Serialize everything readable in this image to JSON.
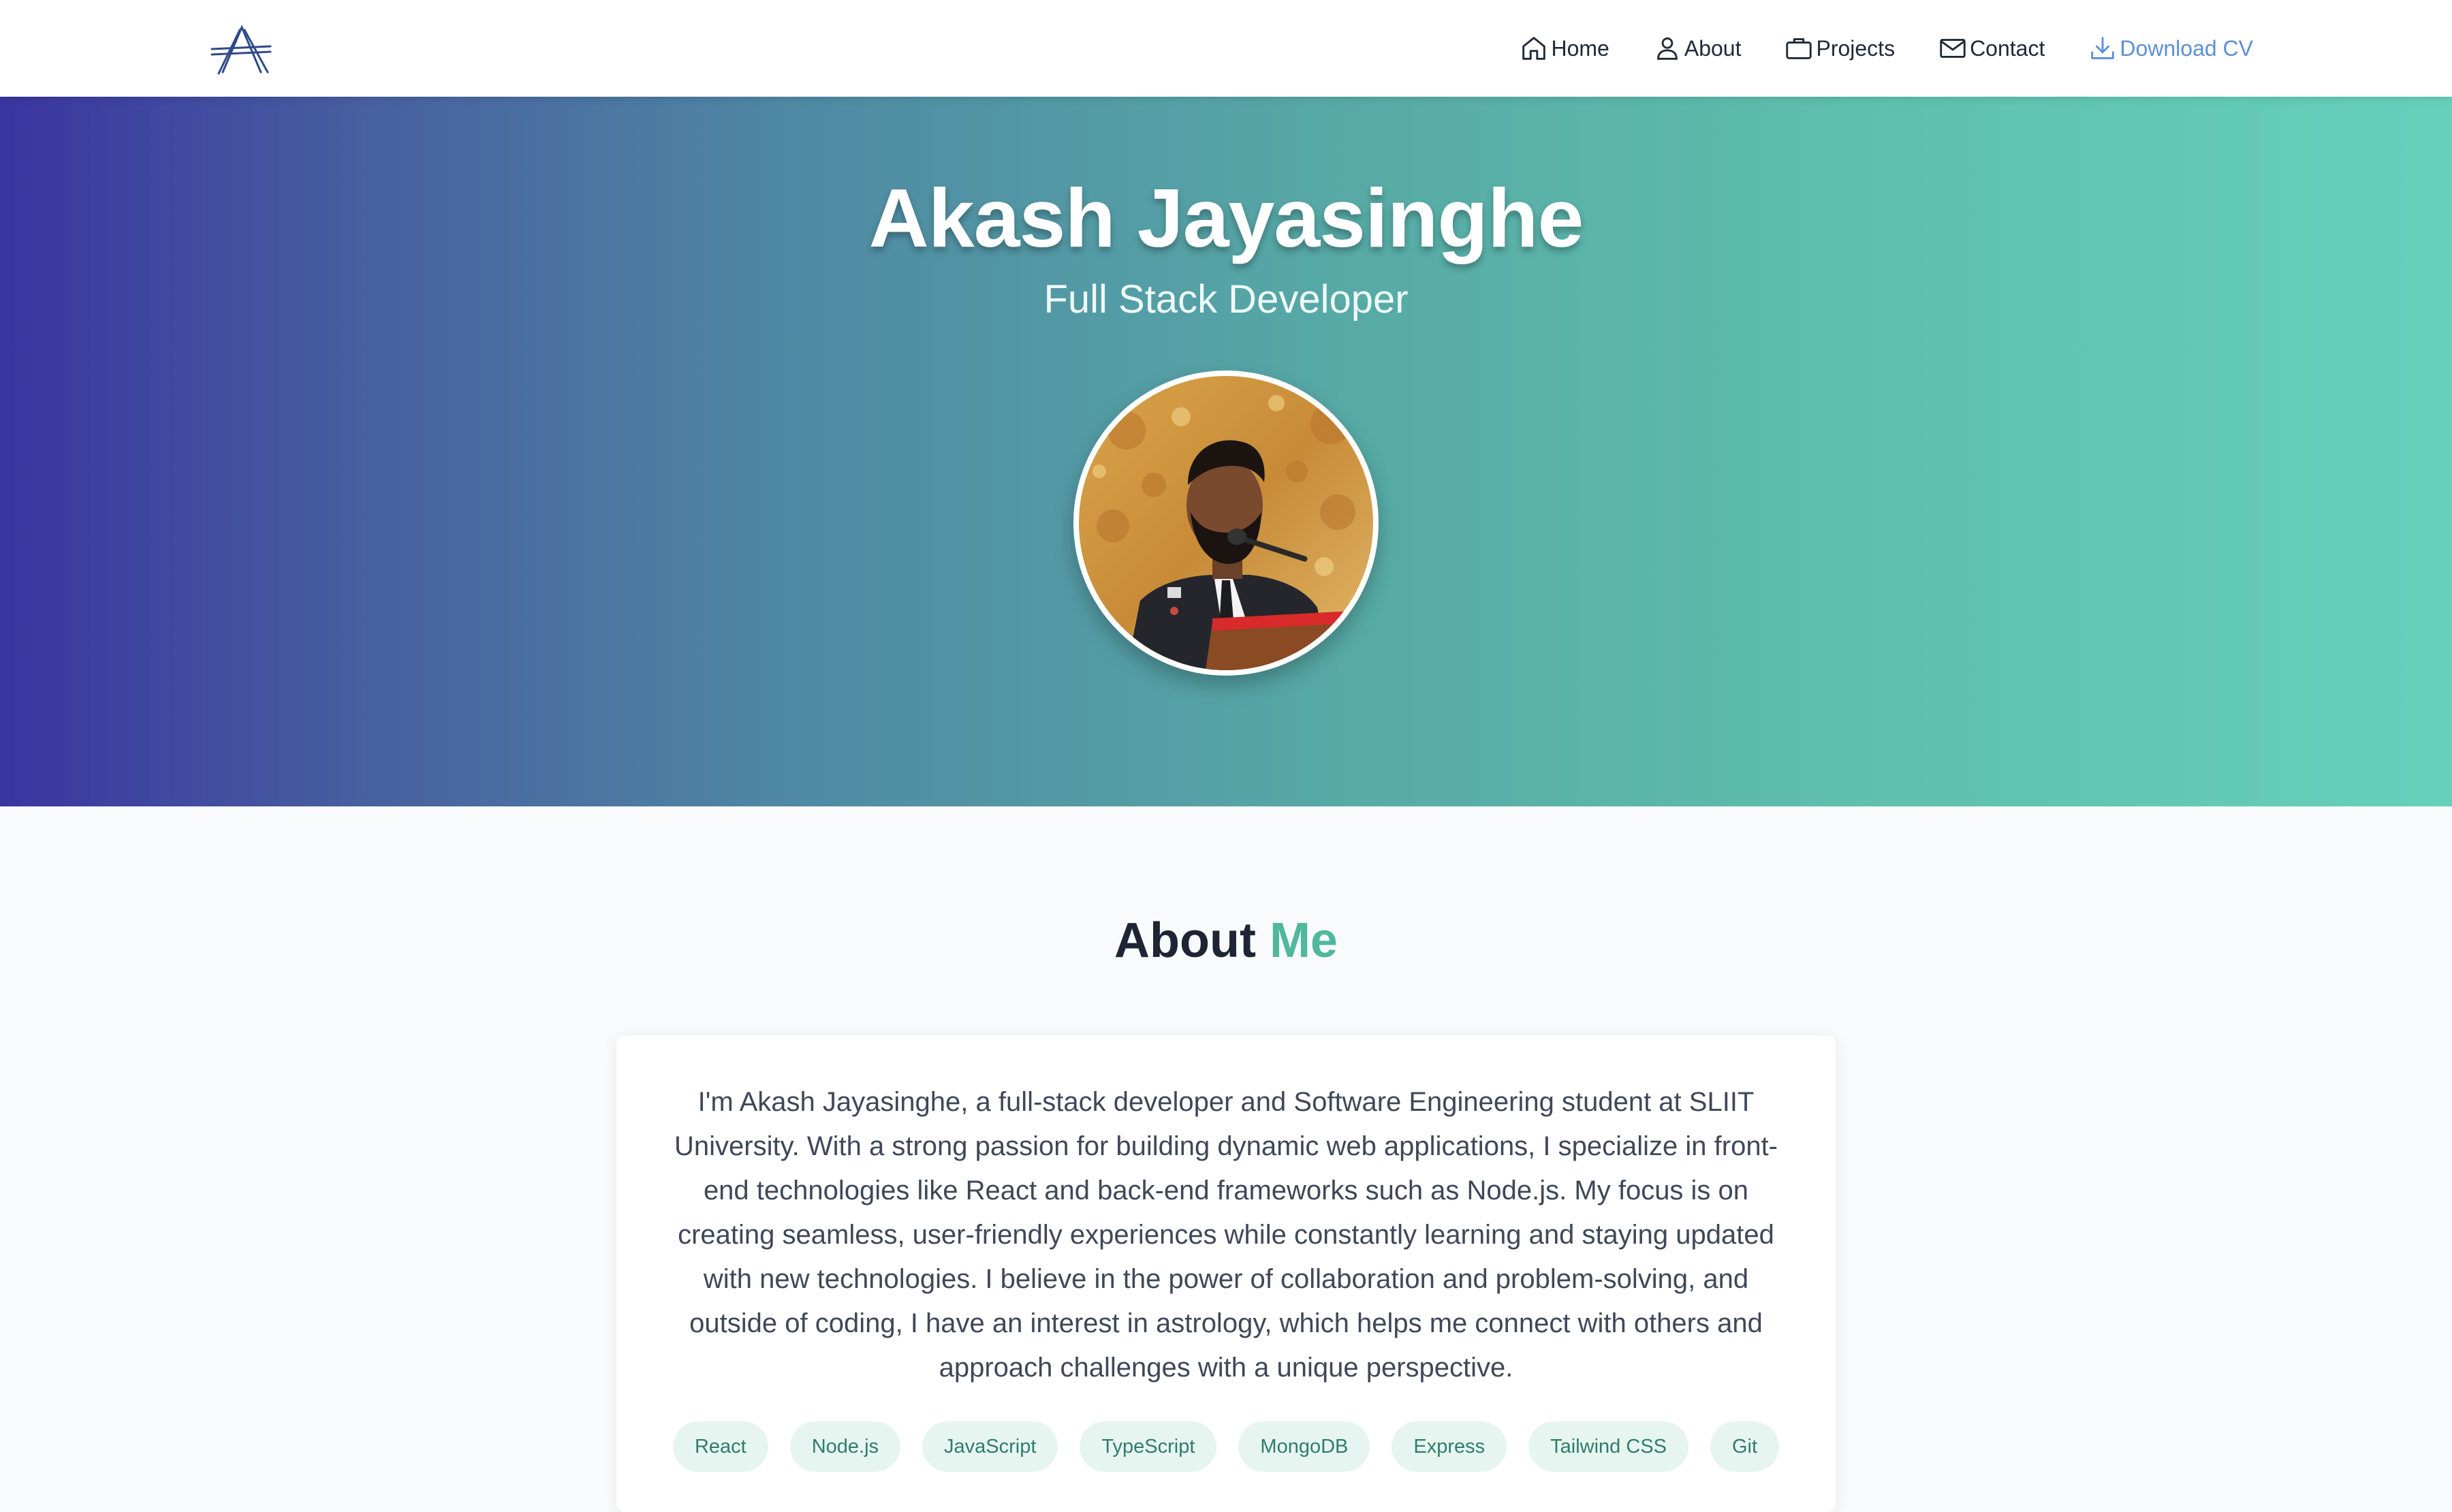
{
  "nav": {
    "logo_icon": "a-monogram-logo",
    "items": [
      {
        "label": "Home",
        "icon": "home-icon"
      },
      {
        "label": "About",
        "icon": "user-icon"
      },
      {
        "label": "Projects",
        "icon": "briefcase-icon"
      },
      {
        "label": "Contact",
        "icon": "mail-icon"
      },
      {
        "label": "Download CV",
        "icon": "download-icon"
      }
    ]
  },
  "hero": {
    "name": "Akash Jayasinghe",
    "role": "Full Stack Developer"
  },
  "about": {
    "heading_main": "About",
    "heading_accent": "Me",
    "text": "I'm Akash Jayasinghe, a full-stack developer and Software Engineering student at SLIIT University. With a strong passion for building dynamic web applications, I specialize in front-end technologies like React and back-end frameworks such as Node.js. My focus is on creating seamless, user-friendly experiences while constantly learning and staying updated with new technologies. I believe in the power of collaboration and problem-solving, and outside of coding, I have an interest in astrology, which helps me connect with others and approach challenges with a unique perspective.",
    "skills": [
      "React",
      "Node.js",
      "JavaScript",
      "TypeScript",
      "MongoDB",
      "Express",
      "Tailwind CSS",
      "Git"
    ]
  },
  "colors": {
    "accent": "#4fb89e",
    "download_link": "#5b8fd6",
    "hero_gradient_start": "#3a35a0",
    "hero_gradient_end": "#66d0bb",
    "heading_dark": "#1e2433"
  }
}
